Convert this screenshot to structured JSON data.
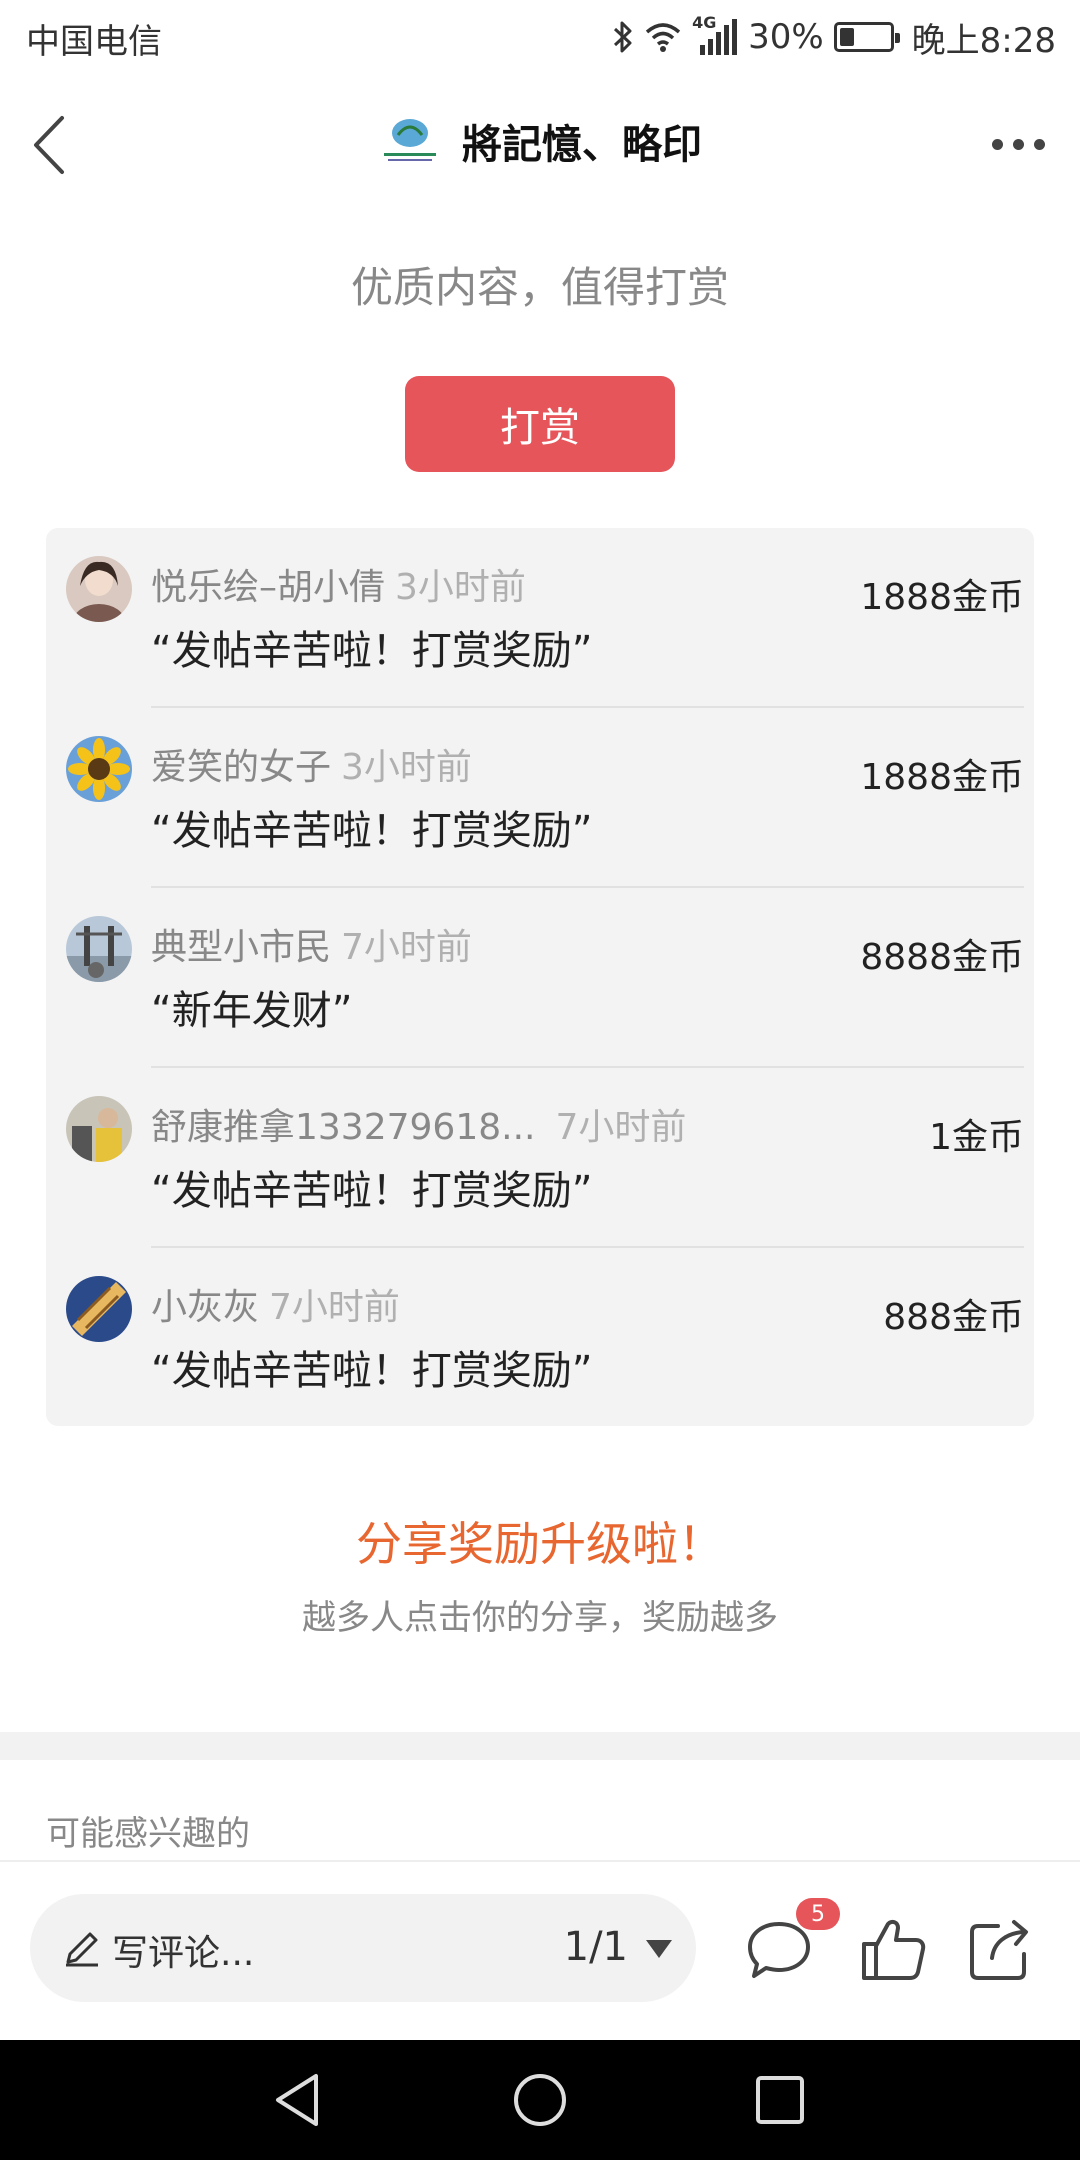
{
  "status_bar": {
    "carrier": "中国电信",
    "network": "4G",
    "battery_percent": "30%",
    "battery_level": 0.3,
    "time": "晚上8:28"
  },
  "header": {
    "title": "將記憶、略印",
    "logo_icon": "group-logo-icon"
  },
  "reward": {
    "prompt": "优质内容，值得打赏",
    "button_label": "打赏",
    "button_color": "#e5555a"
  },
  "rewards": [
    {
      "name": "悦乐绘–胡小倩",
      "time": "3小时前",
      "message": "“发帖辛苦啦！打赏奖励”",
      "amount": "1888金币"
    },
    {
      "name": "爱笑的女子",
      "time": "3小时前",
      "message": "“发帖辛苦啦！打赏奖励”",
      "amount": "1888金币"
    },
    {
      "name": "典型小市民",
      "time": "7小时前",
      "message": "“新年发财”",
      "amount": "8888金币"
    },
    {
      "name": "舒康推拿133279618...",
      "time": "7小时前",
      "message": "“发帖辛苦啦！打赏奖励”",
      "amount": "1金币"
    },
    {
      "name": "小灰灰",
      "time": "7小时前",
      "message": "“发帖辛苦啦！打赏奖励”",
      "amount": "888金币"
    }
  ],
  "share": {
    "title": "分享奖励升级啦！",
    "subtitle": "越多人点击你的分享，奖励越多",
    "title_color": "#e8662f"
  },
  "interest": {
    "label": "可能感兴趣的"
  },
  "bottom_bar": {
    "comment_placeholder": "写评论...",
    "pager": "1/1",
    "comment_count": "5"
  }
}
